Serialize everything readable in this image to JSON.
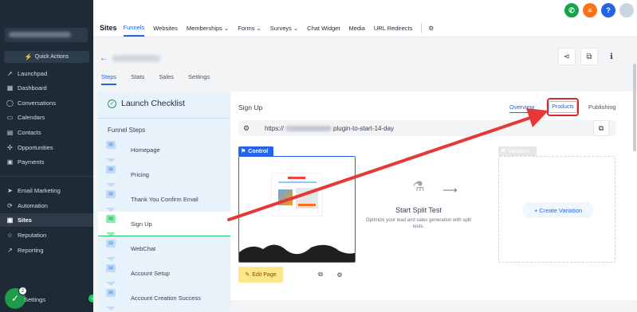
{
  "sidebar": {
    "quick_actions": "Quick Actions",
    "items": [
      {
        "label": "Launchpad",
        "icon": "rocket-icon"
      },
      {
        "label": "Dashboard",
        "icon": "grid-icon"
      },
      {
        "label": "Conversations",
        "icon": "chat-icon"
      },
      {
        "label": "Calendars",
        "icon": "calendar-icon"
      },
      {
        "label": "Contacts",
        "icon": "contacts-icon"
      },
      {
        "label": "Opportunities",
        "icon": "opportunities-icon"
      },
      {
        "label": "Payments",
        "icon": "payments-icon"
      },
      {
        "label": "Email Marketing",
        "icon": "send-icon"
      },
      {
        "label": "Automation",
        "icon": "automation-icon"
      },
      {
        "label": "Sites",
        "icon": "sites-icon"
      },
      {
        "label": "Reputation",
        "icon": "star-icon"
      },
      {
        "label": "Reporting",
        "icon": "chart-icon"
      }
    ],
    "active": "Sites",
    "settings": "Settings",
    "notification_count": "2"
  },
  "topbar": {
    "section_title": "Sites",
    "tabs": [
      {
        "label": "Funnels",
        "active": true,
        "dropdown": false
      },
      {
        "label": "Websites",
        "active": false,
        "dropdown": false
      },
      {
        "label": "Memberships",
        "active": false,
        "dropdown": true
      },
      {
        "label": "Forms",
        "active": false,
        "dropdown": true
      },
      {
        "label": "Surveys",
        "active": false,
        "dropdown": true
      },
      {
        "label": "Chat Widget",
        "active": false,
        "dropdown": false
      },
      {
        "label": "Media",
        "active": false,
        "dropdown": false
      },
      {
        "label": "URL Redirects",
        "active": false,
        "dropdown": false
      }
    ],
    "help_label": "?"
  },
  "funnel": {
    "subtabs": [
      "Steps",
      "Stats",
      "Sales",
      "Settings"
    ],
    "active_subtab": "Steps"
  },
  "checklist": {
    "title": "Launch Checklist",
    "funnel_steps_label": "Funnel Steps",
    "steps": [
      "Homepage",
      "Pricing",
      "Thank You Confirm Email",
      "Sign Up",
      "WebChat",
      "Account Setup",
      "Account Creation Success"
    ],
    "active_step": "Sign Up"
  },
  "step_detail": {
    "title": "Sign Up",
    "tabs": [
      "Overview",
      "Products",
      "Publishing"
    ],
    "active_tab": "Overview",
    "highlighted_tab": "Products",
    "url_prefix": "https://",
    "url_suffix": "plugin-to-start-14-day",
    "control_label": "Control",
    "edit_page": "Edit Page",
    "split_title": "Start Split Test",
    "split_desc": "Optimize your lead and sales generation with split tests.",
    "variation_label": "Variation",
    "create_variation": "+ Create Variation"
  },
  "colors": {
    "sidebar_bg": "#1f2a37",
    "accent": "#2563eb",
    "annotation": "#dc2626",
    "success": "#16a34a"
  }
}
